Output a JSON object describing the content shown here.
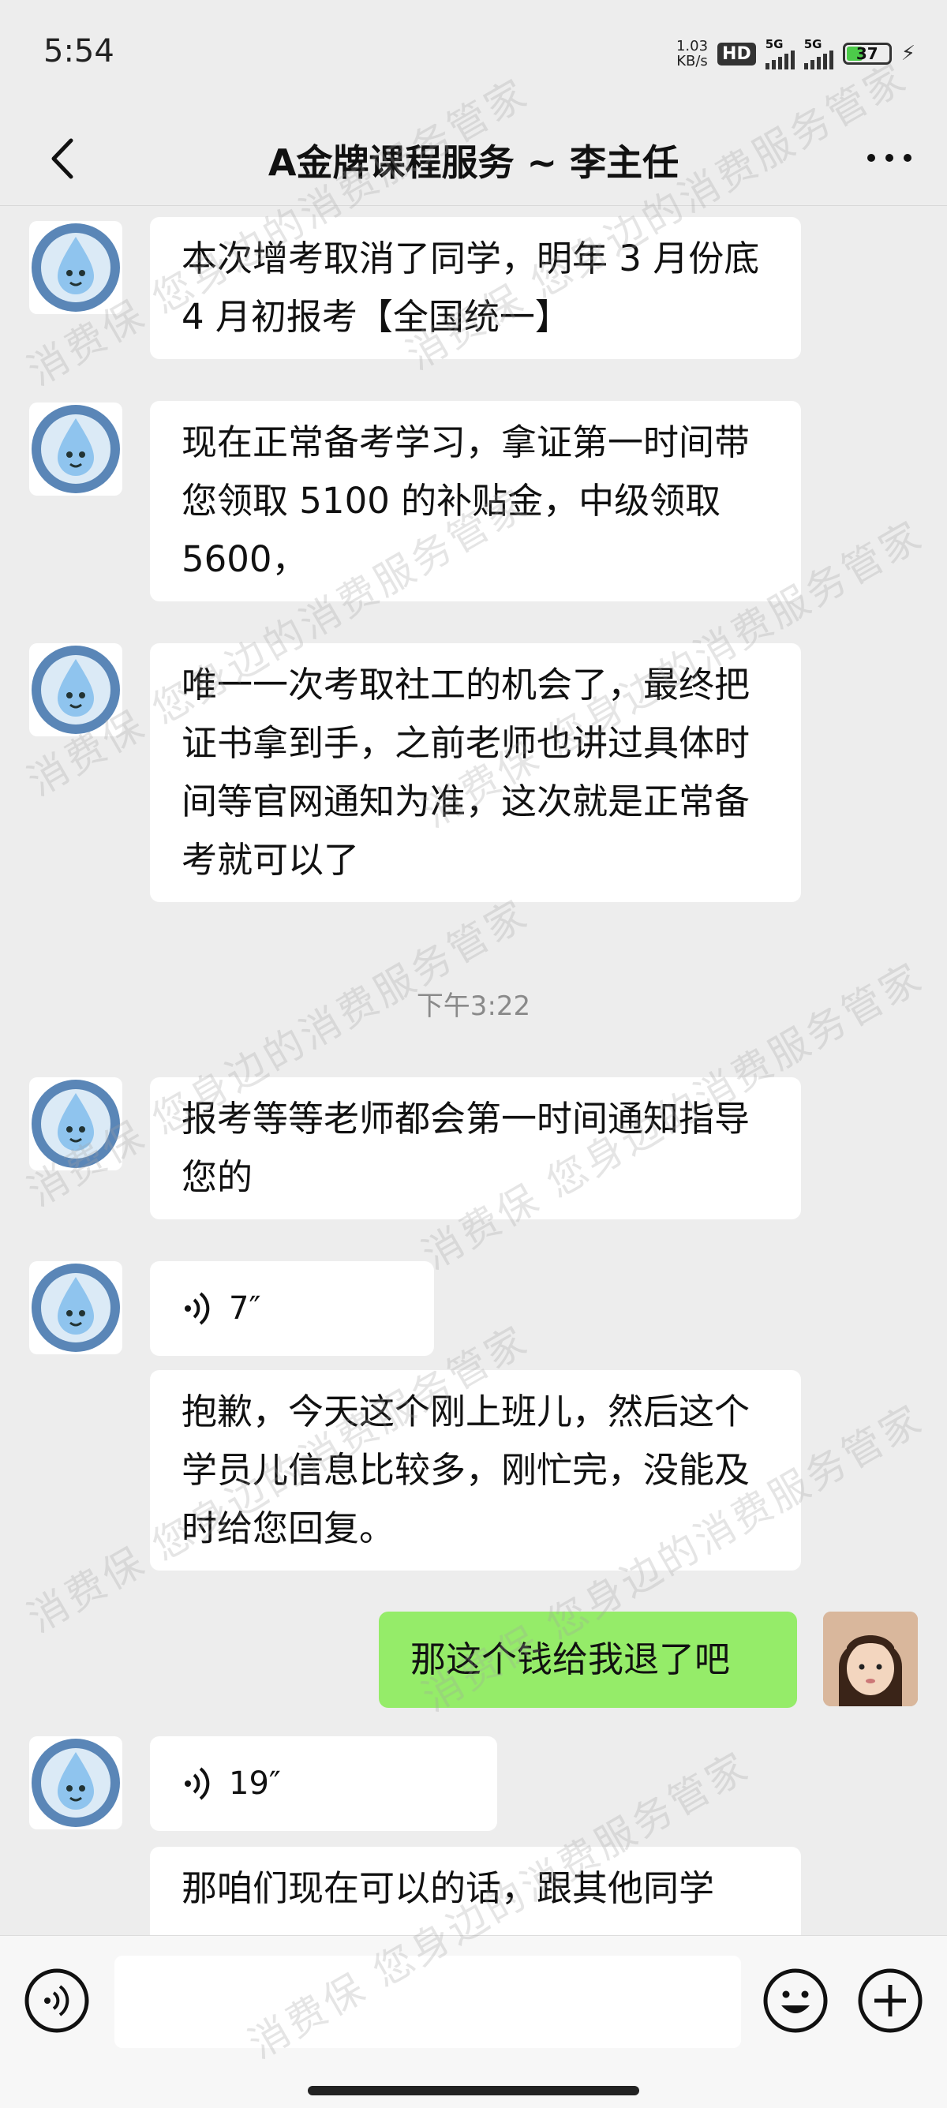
{
  "status_bar": {
    "time": "5:54",
    "net_speed_value": "1.03",
    "net_speed_unit": "KB/s",
    "hd_label": "HD",
    "signal1_label": "5G",
    "signal2_label": "5G",
    "battery": "37"
  },
  "header": {
    "title": "A金牌课程服务 ~ 李主任"
  },
  "messages": [
    {
      "side": "left",
      "type": "text",
      "text": "本次增考取消了同学，明年 3 月份底 4 月初报考【全国统一】"
    },
    {
      "side": "left",
      "type": "text",
      "text": "现在正常备考学习，拿证第一时间带您领取 5100 的补贴金，中级领取 5600，"
    },
    {
      "side": "left",
      "type": "text",
      "text": "唯一一次考取社工的机会了，最终把证书拿到手，之前老师也讲过具体时间等官网通知为准，这次就是正常备考就可以了"
    },
    {
      "type": "timestamp",
      "text": "下午3:22"
    },
    {
      "side": "left",
      "type": "text",
      "text": "报考等等老师都会第一时间通知指导您的"
    },
    {
      "side": "left",
      "type": "voice",
      "duration": "7″"
    },
    {
      "side": "left",
      "type": "text",
      "text": "抱歉，今天这个刚上班儿，然后这个学员儿信息比较多，刚忙完，没能及时给您回复。"
    },
    {
      "side": "right",
      "type": "text",
      "text": "那这个钱给我退了吧"
    },
    {
      "side": "left",
      "type": "voice",
      "duration": "19″"
    },
    {
      "side": "left",
      "type": "text",
      "text": "那咱们现在可以的话，跟其他同学"
    }
  ],
  "watermark": "消费保 您身边的消费服务管家",
  "colors": {
    "background": "#ededed",
    "bubble_left": "#ffffff",
    "bubble_right": "#95ec69",
    "input_bar": "#f7f7f7"
  },
  "icons": [
    "back-arrow-icon",
    "more-dots-icon",
    "voice-wave-icon",
    "voice-mode-icon",
    "emoji-icon",
    "plus-icon",
    "avatar-mascot-icon",
    "avatar-child-photo"
  ]
}
